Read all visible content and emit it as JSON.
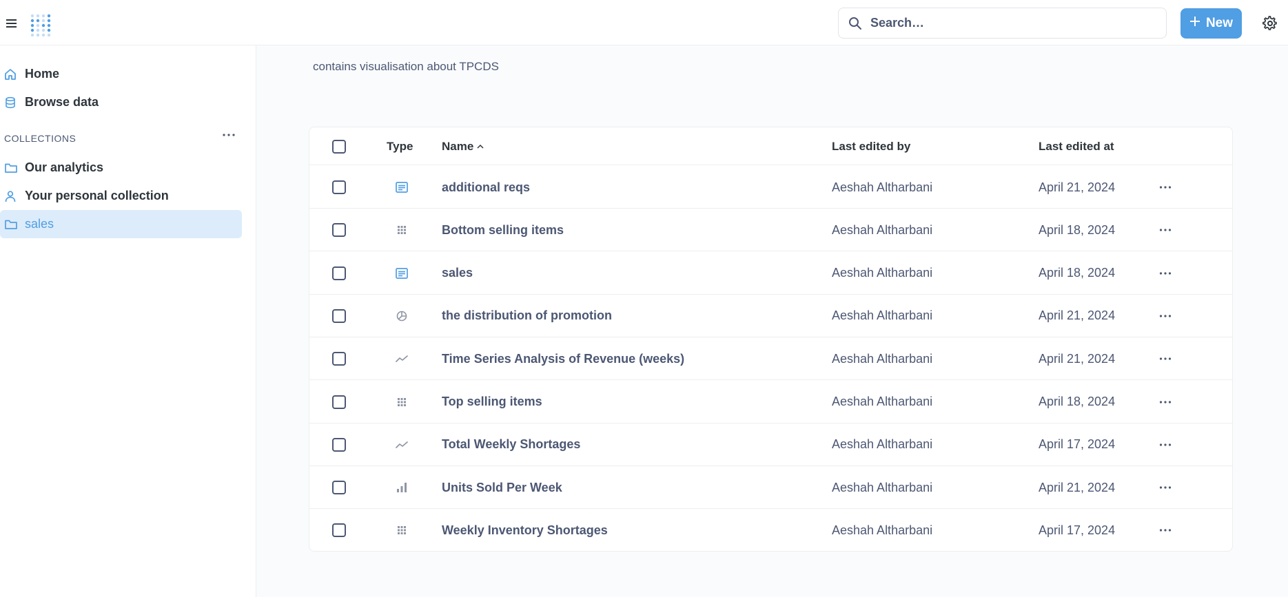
{
  "topbar": {
    "search_placeholder": "Search…",
    "new_label": "New"
  },
  "sidebar": {
    "home": "Home",
    "browse": "Browse data",
    "section_title": "COLLECTIONS",
    "collections": [
      {
        "label": "Our analytics",
        "icon": "folder-icon"
      },
      {
        "label": "Your personal collection",
        "icon": "person-icon"
      },
      {
        "label": "sales",
        "icon": "folder-icon",
        "active": true
      }
    ]
  },
  "collection": {
    "description": "contains visualisation about TPCDS"
  },
  "table": {
    "headers": {
      "type": "Type",
      "name": "Name",
      "last_edited_by": "Last edited by",
      "last_edited_at": "Last edited at"
    },
    "sort": {
      "column": "name",
      "direction": "ascending"
    },
    "rows": [
      {
        "type": "dashboard",
        "name": "additional reqs",
        "by": "Aeshah Altharbani",
        "at": "April 21, 2024"
      },
      {
        "type": "grid",
        "name": "Bottom selling items",
        "by": "Aeshah Altharbani",
        "at": "April 18, 2024"
      },
      {
        "type": "dashboard",
        "name": "sales",
        "by": "Aeshah Altharbani",
        "at": "April 18, 2024"
      },
      {
        "type": "pie",
        "name": "the distribution of promotion",
        "by": "Aeshah Altharbani",
        "at": "April 21, 2024"
      },
      {
        "type": "line",
        "name": "Time Series Analysis of Revenue (weeks)",
        "by": "Aeshah Altharbani",
        "at": "April 21, 2024"
      },
      {
        "type": "grid",
        "name": "Top selling items",
        "by": "Aeshah Altharbani",
        "at": "April 18, 2024"
      },
      {
        "type": "line",
        "name": "Total Weekly Shortages",
        "by": "Aeshah Altharbani",
        "at": "April 17, 2024"
      },
      {
        "type": "bar",
        "name": "Units Sold Per Week",
        "by": "Aeshah Altharbani",
        "at": "April 21, 2024"
      },
      {
        "type": "grid",
        "name": "Weekly Inventory Shortages",
        "by": "Aeshah Altharbani",
        "at": "April 17, 2024"
      }
    ]
  },
  "colors": {
    "brand": "#509ee3",
    "active_bg": "#ddecfa",
    "text": "#4c5773"
  }
}
